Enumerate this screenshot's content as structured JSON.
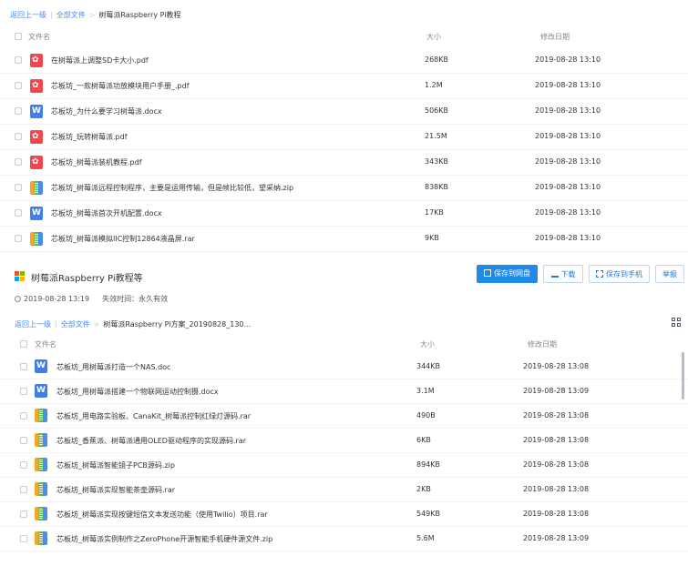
{
  "top": {
    "breadcrumb": {
      "back": "返回上一级",
      "all": "全部文件",
      "current": "树莓派Raspberry Pi教程"
    },
    "headers": {
      "name": "文件名",
      "size": "大小",
      "date": "修改日期"
    },
    "files": [
      {
        "name": "在树莓派上调整SD卡大小.pdf",
        "size": "268KB",
        "date": "2019-08-28 13:10",
        "type": "pdf"
      },
      {
        "name": "芯板坊_一款树莓派功放模块用户手册_.pdf",
        "size": "1.2M",
        "date": "2019-08-28 13:10",
        "type": "pdf"
      },
      {
        "name": "芯板坊_为什么要学习树莓派.docx",
        "size": "506KB",
        "date": "2019-08-28 13:10",
        "type": "word"
      },
      {
        "name": "芯板坊_玩转树莓派.pdf",
        "size": "21.5M",
        "date": "2019-08-28 13:10",
        "type": "pdf"
      },
      {
        "name": "芯板坊_树莓派装机教程.pdf",
        "size": "343KB",
        "date": "2019-08-28 13:10",
        "type": "pdf"
      },
      {
        "name": "芯板坊_树莓派远程控制程序，主要是运用传输，但是帧比较低，望采纳.zip",
        "size": "838KB",
        "date": "2019-08-28 13:10",
        "type": "zip"
      },
      {
        "name": "芯板坊_树莓派首次开机配置.docx",
        "size": "17KB",
        "date": "2019-08-28 13:10",
        "type": "word"
      },
      {
        "name": "芯板坊_树莓派模拟IIC控制12864液晶屏.rar",
        "size": "9KB",
        "date": "2019-08-28 13:10",
        "type": "zip"
      }
    ]
  },
  "share": {
    "title": "树莓派Raspberry Pi教程等",
    "time": "2019-08-28 13:19",
    "expire": "失效时间：永久有效",
    "buttons": {
      "save_cloud": "保存到网盘",
      "download": "下载",
      "save_phone": "保存到手机",
      "report": "举报"
    },
    "logo_colors": [
      "#f25022",
      "#7fba00",
      "#00a4ef",
      "#ffb900"
    ]
  },
  "bottom": {
    "breadcrumb": {
      "back": "返回上一级",
      "all": "全部文件",
      "current": "树莓派Raspberry Pi方案_20190828_130..."
    },
    "headers": {
      "name": "文件名",
      "size": "大小",
      "date": "修改日期"
    },
    "files": [
      {
        "name": "芯板坊_用树莓派打造一个NAS.doc",
        "size": "344KB",
        "date": "2019-08-28 13:08",
        "type": "word"
      },
      {
        "name": "芯板坊_用树莓派搭建一个物联网运动控制摄.docx",
        "size": "3.1M",
        "date": "2019-08-28 13:09",
        "type": "word"
      },
      {
        "name": "芯板坊_用电路实验板、CanaKit_树莓派控制红绿灯源码.rar",
        "size": "490B",
        "date": "2019-08-28 13:08",
        "type": "zip"
      },
      {
        "name": "芯板坊_香蕉派、树莓派通用OLED驱动程序的实现源码.rar",
        "size": "6KB",
        "date": "2019-08-28 13:08",
        "type": "zip"
      },
      {
        "name": "芯板坊_树莓派智能镜子PCB源码.zip",
        "size": "894KB",
        "date": "2019-08-28 13:08",
        "type": "zip"
      },
      {
        "name": "芯板坊_树莓派实现智能茶壶源码.rar",
        "size": "2KB",
        "date": "2019-08-28 13:08",
        "type": "zip"
      },
      {
        "name": "芯板坊_树莓派实现按键短信文本发送功能（使用Twilio）项目.rar",
        "size": "549KB",
        "date": "2019-08-28 13:08",
        "type": "zip"
      },
      {
        "name": "芯板坊_树莓派实例制作之ZeroPhone开源智能手机硬件源文件.zip",
        "size": "5.6M",
        "date": "2019-08-28 13:09",
        "type": "zip"
      }
    ]
  }
}
